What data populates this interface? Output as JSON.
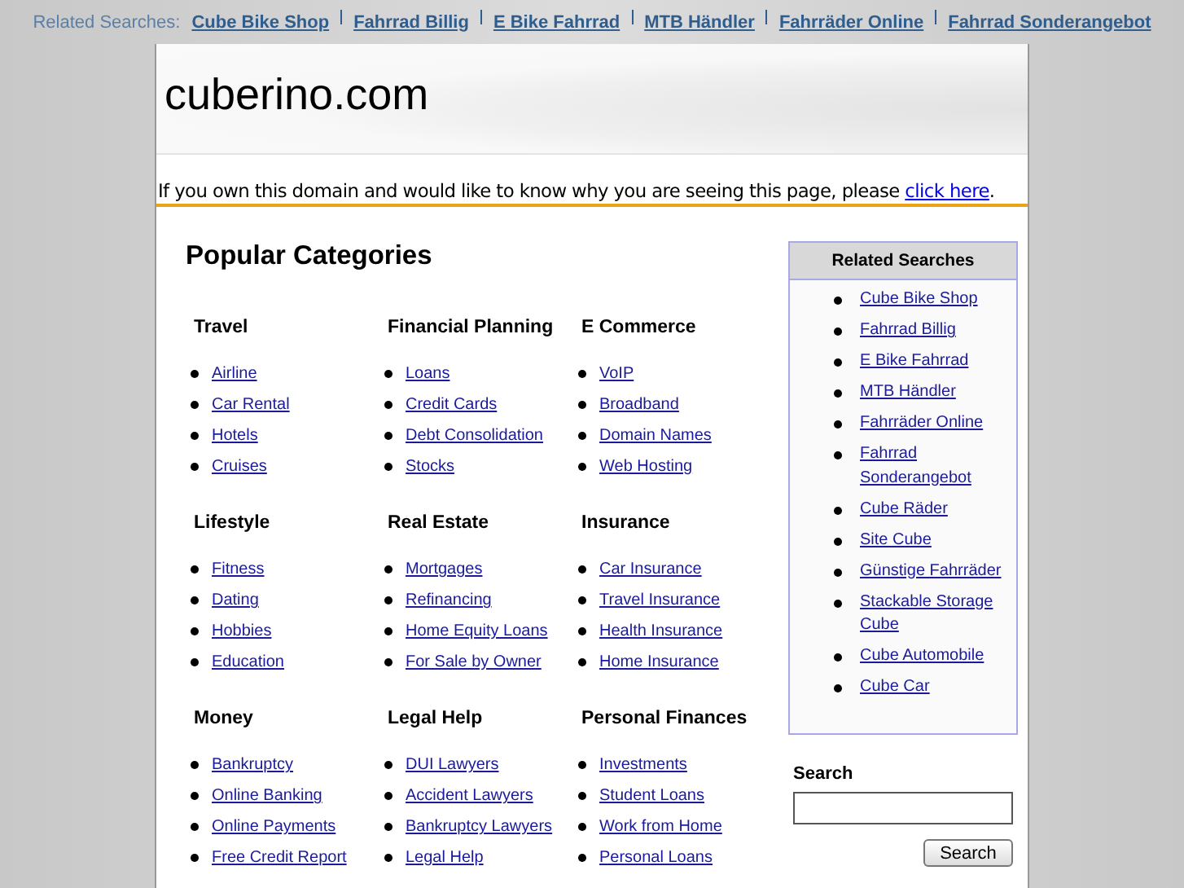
{
  "top_bar": {
    "label": "Related Searches:",
    "links": [
      "Cube Bike Shop",
      "Fahrrad Billig",
      "E Bike Fahrrad",
      "MTB Händler",
      "Fahrräder Online",
      "Fahrrad Sonderangebot"
    ]
  },
  "header": {
    "title": "cuberino.com"
  },
  "notice": {
    "text": "If you own this domain and would like to know why you are seeing this page, please ",
    "link": "click here",
    "end": "."
  },
  "categories": {
    "title": "Popular Categories",
    "groups": [
      {
        "heading": "Travel",
        "links": [
          "Airline",
          "Car Rental",
          "Hotels",
          "Cruises"
        ]
      },
      {
        "heading": "Financial Planning",
        "links": [
          "Loans",
          "Credit Cards",
          "Debt Consolidation",
          "Stocks"
        ]
      },
      {
        "heading": "E Commerce",
        "links": [
          "VoIP",
          "Broadband",
          "Domain Names",
          "Web Hosting"
        ]
      },
      {
        "heading": "Lifestyle",
        "links": [
          "Fitness",
          "Dating",
          "Hobbies",
          "Education"
        ]
      },
      {
        "heading": "Real Estate",
        "links": [
          "Mortgages",
          "Refinancing",
          "Home Equity Loans",
          "For Sale by Owner"
        ]
      },
      {
        "heading": "Insurance",
        "links": [
          "Car Insurance",
          "Travel Insurance",
          "Health Insurance",
          "Home Insurance"
        ]
      },
      {
        "heading": "Money",
        "links": [
          "Bankruptcy",
          "Online Banking",
          "Online Payments",
          "Free Credit Report"
        ]
      },
      {
        "heading": "Legal Help",
        "links": [
          "DUI Lawyers",
          "Accident Lawyers",
          "Bankruptcy Lawyers",
          "Legal Help"
        ]
      },
      {
        "heading": "Personal Finances",
        "links": [
          "Investments",
          "Student Loans",
          "Work from Home",
          "Personal Loans"
        ]
      }
    ]
  },
  "related": {
    "title": "Related Searches",
    "links": [
      "Cube Bike Shop",
      "Fahrrad Billig",
      "E Bike Fahrrad",
      "MTB Händler",
      "Fahrräder Online",
      "Fahrrad Sonderangebot",
      "Cube Räder",
      "Site Cube",
      "Günstige Fahrräder",
      "Stackable Storage Cube",
      "Cube Automobile",
      "Cube Car"
    ]
  },
  "search": {
    "label": "Search",
    "button": "Search"
  }
}
